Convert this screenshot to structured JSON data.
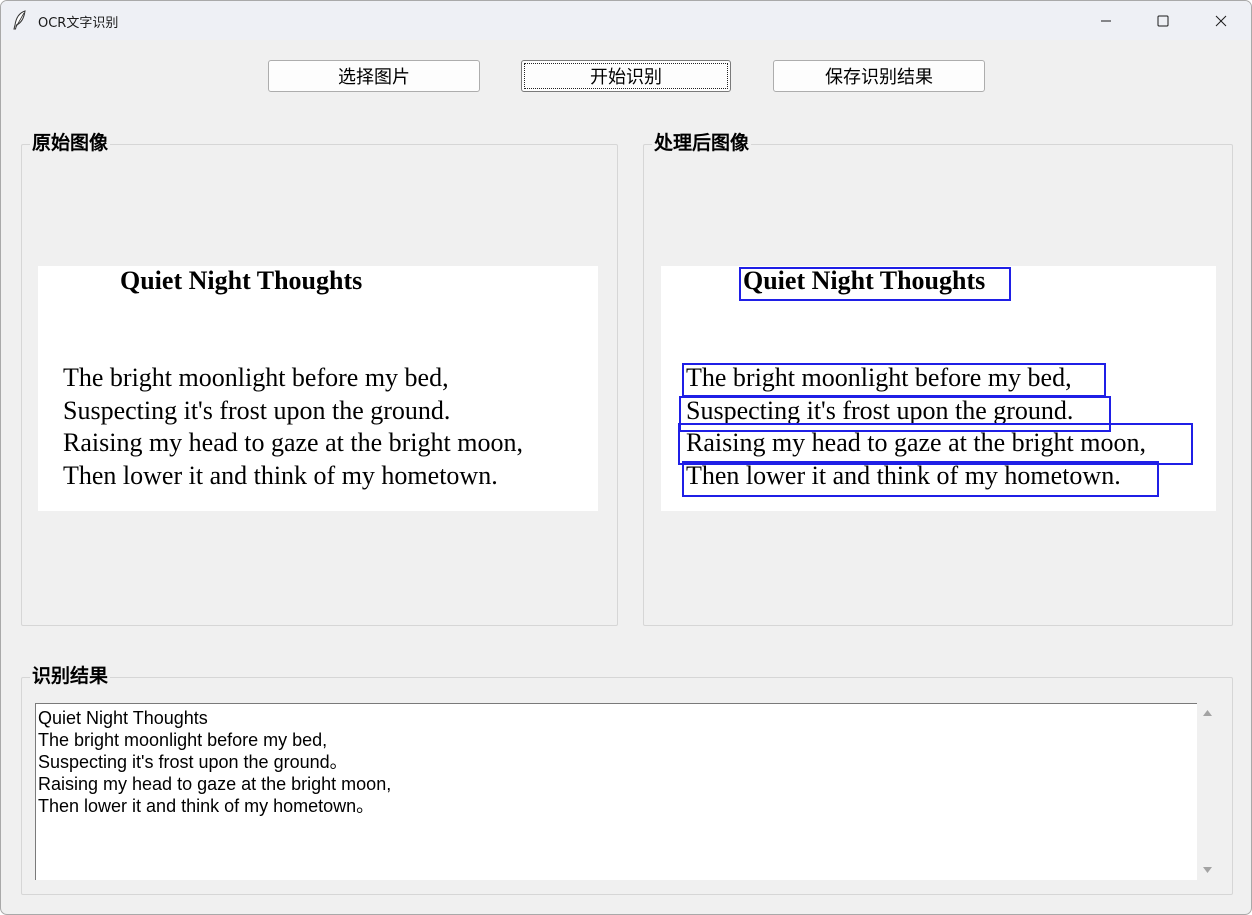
{
  "window": {
    "title": "OCR文字识别"
  },
  "toolbar": {
    "select_label": "选择图片",
    "start_label": "开始识别",
    "save_label": "保存识别结果"
  },
  "panels": {
    "original_label": "原始图像",
    "processed_label": "处理后图像",
    "result_label": "识别结果"
  },
  "poem": {
    "title": "Quiet Night Thoughts",
    "lines": [
      "The bright moonlight before my bed,",
      "Suspecting it's frost upon the ground.",
      "Raising my head to gaze at the bright moon,",
      "Then lower it and think of my hometown."
    ]
  },
  "result": {
    "lines": [
      "Quiet Night Thoughts",
      "The bright moonlight before my bed,",
      "Suspecting it's frost upon the ground。",
      "Raising my head to gaze at the bright moon,",
      "Then lower it and think of my hometown。"
    ]
  },
  "colors": {
    "window_bg": "#f0f0f0",
    "detection_box": "#1f1fe6"
  },
  "icons": {
    "app": "feather-icon",
    "minimize": "minimize-icon",
    "maximize": "maximize-icon",
    "close": "close-icon",
    "scroll_up": "scroll-up-arrow-icon",
    "scroll_down": "scroll-down-arrow-icon"
  }
}
